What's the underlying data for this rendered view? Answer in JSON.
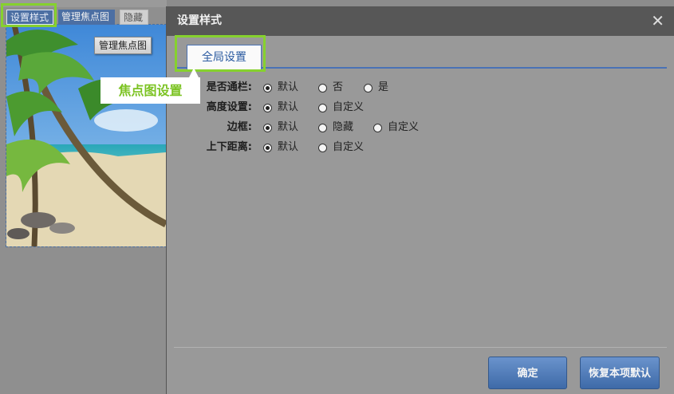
{
  "editor": {
    "toolbar": {
      "style_label": "设置样式",
      "manage_label": "管理焦点图",
      "hide_label": "隐藏"
    },
    "floating_manage_label": "管理焦点图",
    "callout_label": "焦点图设置"
  },
  "dialog": {
    "title": "设置样式",
    "close_icon": "close-icon",
    "tab_label": "全局设置",
    "settings": [
      {
        "label": "是否通栏:",
        "options": [
          "默认",
          "否",
          "是"
        ],
        "selected": 0
      },
      {
        "label": "高度设置:",
        "options": [
          "默认",
          "自定义"
        ],
        "selected": 0
      },
      {
        "label": "边框:",
        "options": [
          "默认",
          "隐藏",
          "自定义"
        ],
        "selected": 0
      },
      {
        "label": "上下距离:",
        "options": [
          "默认",
          "自定义"
        ],
        "selected": 0
      }
    ],
    "buttons": {
      "ok": "确定",
      "reset": "恢复本项默认"
    }
  },
  "colors": {
    "highlight_green": "#86d12e",
    "accent_blue": "#4a72b5",
    "callout_text": "#7cc323",
    "dialog_header": "#575757"
  }
}
